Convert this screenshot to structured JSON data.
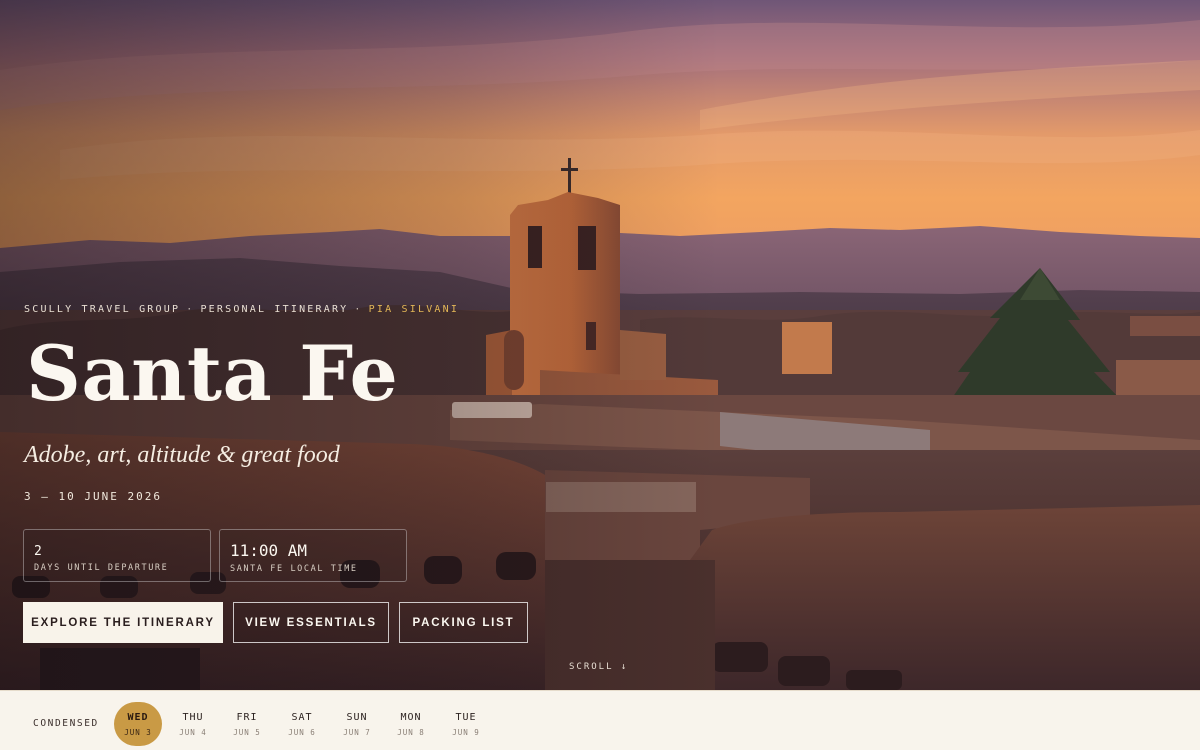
{
  "hero": {
    "eyebrow": {
      "org": "SCULLY TRAVEL GROUP",
      "separator": "·",
      "kind": "PERSONAL ITINERARY",
      "traveler": "PIA SILVANI"
    },
    "title": "Santa Fe",
    "subtitle": "Adobe, art, altitude & great food",
    "dates": "3 — 10 JUNE 2026",
    "stats": [
      {
        "value": "2",
        "label": "DAYS UNTIL DEPARTURE"
      },
      {
        "value": "11:00 AM",
        "label": "SANTA FE LOCAL TIME"
      }
    ],
    "buttons": {
      "primary": "EXPLORE THE ITINERARY",
      "essentials": "VIEW ESSENTIALS",
      "packing": "PACKING LIST"
    },
    "scroll_hint": "SCROLL ↓"
  },
  "day_strip": {
    "mode_label": "CONDENSED",
    "days": [
      {
        "day": "WED",
        "date": "JUN 3",
        "active": true
      },
      {
        "day": "THU",
        "date": "JUN 4",
        "active": false
      },
      {
        "day": "FRI",
        "date": "JUN 5",
        "active": false
      },
      {
        "day": "SAT",
        "date": "JUN 6",
        "active": false
      },
      {
        "day": "SUN",
        "date": "JUN 7",
        "active": false
      },
      {
        "day": "MON",
        "date": "JUN 8",
        "active": false
      },
      {
        "day": "TUE",
        "date": "JUN 9",
        "active": false
      }
    ]
  },
  "colors": {
    "accent": "#c99a45",
    "traveler_highlight": "#e2b657",
    "strip_background": "#f8f4ec",
    "text_light": "#fbf7f0"
  }
}
